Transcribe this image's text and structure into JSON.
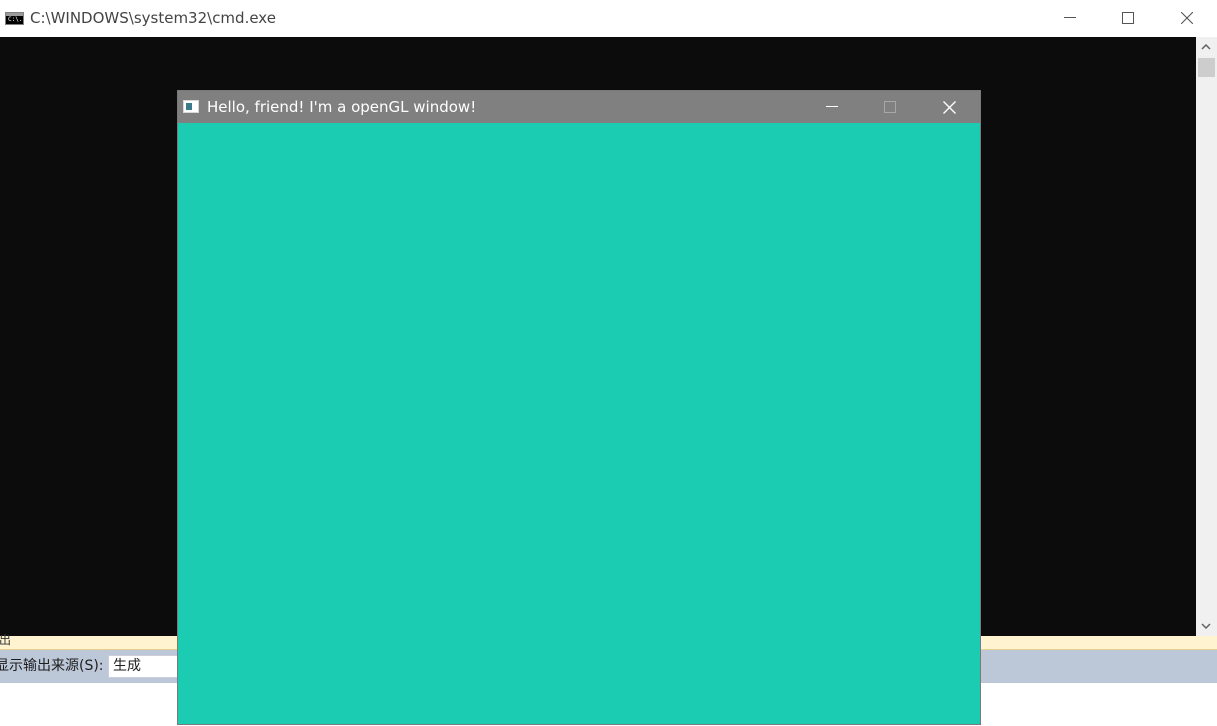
{
  "cmd_window": {
    "title": "C:\\WINDOWS\\system32\\cmd.exe",
    "icon_text": "C:\\.",
    "icon": "console-icon",
    "background_color": "#0c0c0c",
    "controls": {
      "minimize_icon": "minimize-icon",
      "maximize_icon": "maximize-icon",
      "close_icon": "close-icon"
    },
    "scrollbar": {
      "up_icon": "chevron-up-icon",
      "down_icon": "chevron-down-icon"
    }
  },
  "gl_window": {
    "title": "Hello, friend! I'm a openGL window!",
    "icon": "application-window-icon",
    "titlebar_color": "#808080",
    "clear_color": "#1bcbb2",
    "controls": {
      "minimize_icon": "minimize-icon",
      "maximize_icon": "maximize-icon",
      "maximize_disabled": true,
      "close_icon": "close-icon"
    }
  },
  "output_panel": {
    "tab_fragment": "出",
    "source_label": "显示输出来源(S):",
    "source_value": "生成",
    "toolbar_color": "#bcc7d8",
    "edge_color": "#fff4cf"
  }
}
